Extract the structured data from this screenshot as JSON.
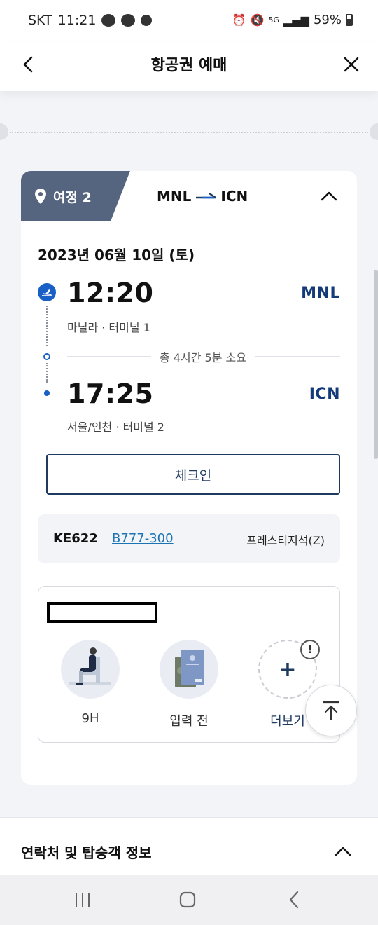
{
  "status_bar": {
    "carrier": "SKT",
    "time": "11:21",
    "network": "5G",
    "battery": "59%",
    "battery_level": 0.59
  },
  "header": {
    "title": "항공권 예매"
  },
  "itinerary": {
    "tag_label": "여정 2",
    "origin": "MNL",
    "destination": "ICN",
    "date": "2023년 06월 10일 (토)",
    "departure": {
      "time": "12:20",
      "code": "MNL",
      "place": "마닐라 · 터미널 1"
    },
    "duration": "총 4시간 5분 소요",
    "arrival": {
      "time": "17:25",
      "code": "ICN",
      "place": "서울/인천 · 터미널 2"
    },
    "checkin_label": "체크인",
    "flight": {
      "number": "KE622",
      "aircraft": "B777-300",
      "cabin": "프레스티지석(Z)"
    },
    "services": [
      {
        "icon": "seat-passenger-icon",
        "label": "9H"
      },
      {
        "icon": "passport-icon",
        "label": "입력 전"
      },
      {
        "icon": "plus-icon",
        "label": "더보기"
      }
    ]
  },
  "contact_section": {
    "title": "연락처 및 탑승객 정보"
  },
  "colors": {
    "primary_navy": "#1f3a5f",
    "accent_blue": "#1960c6",
    "tag_gray": "#56657f",
    "link_blue": "#1a73b5"
  }
}
